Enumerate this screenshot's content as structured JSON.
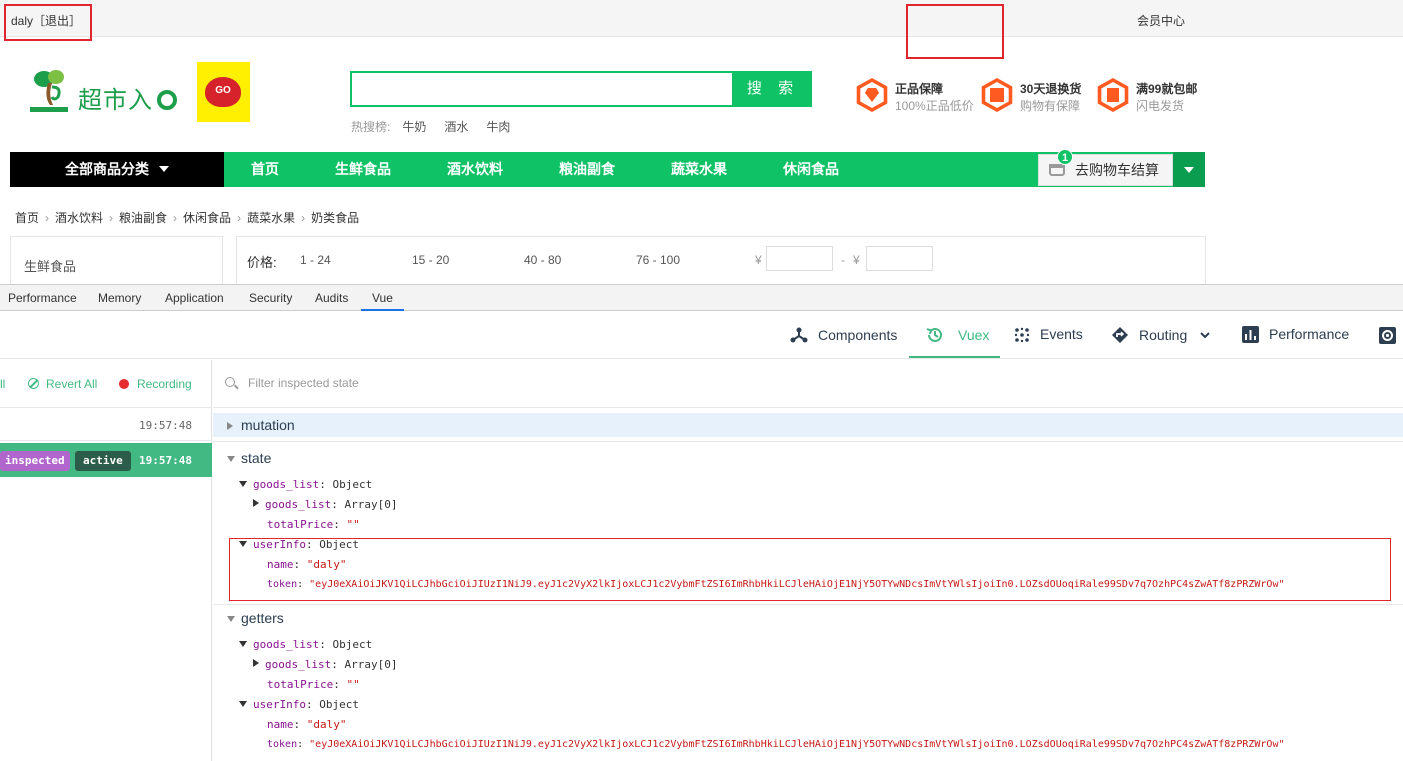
{
  "site": {
    "user": "daly［退出］",
    "member_center": "会员中心",
    "logo_text": "超市入",
    "logo_badge": "GO",
    "search_button": "搜 索",
    "hot_label": "热搜榜:",
    "hot_items": [
      "牛奶",
      "酒水",
      "牛肉"
    ],
    "promises": [
      {
        "title": "正品保障",
        "sub": "100%正品低价"
      },
      {
        "title": "30天退换货",
        "sub": "购物有保障"
      },
      {
        "title": "满99就包邮",
        "sub": "闪电发货"
      }
    ],
    "nav_all": "全部商品分类",
    "nav_items": [
      "首页",
      "生鲜食品",
      "酒水饮料",
      "粮油副食",
      "蔬菜水果",
      "休闲食品"
    ],
    "cart_label": "去购物车结算",
    "cart_count": "1",
    "breadcrumb": [
      "首页",
      "酒水饮料",
      "粮油副食",
      "休闲食品",
      "蔬菜水果",
      "奶类食品"
    ],
    "category": "生鲜食品",
    "price_label": "价格:",
    "price_ranges": [
      "1 - 24",
      "15 - 20",
      "40 - 80",
      "76 - 100"
    ],
    "currency": "¥",
    "dash": "-"
  },
  "devtools": {
    "tabs": [
      "Performance",
      "Memory",
      "Application",
      "Security",
      "Audits",
      "Vue"
    ],
    "active_tab": "Vue",
    "vue_tabs": [
      "Components",
      "Vuex",
      "Events",
      "Routing",
      "Performance"
    ],
    "active_vue_tab": "Vuex",
    "left_toolbar": {
      "partial": "ll",
      "revert": "Revert All",
      "recording": "Recording"
    },
    "history": [
      {
        "time": "19:57:48"
      },
      {
        "tag1": "inspected",
        "tag2": "active",
        "time": "19:57:48"
      }
    ],
    "filter_placeholder": "Filter inspected state",
    "sections": {
      "mutation": "mutation",
      "state": "state",
      "getters": "getters"
    },
    "tree": {
      "goods_list_key": "goods_list",
      "object": "Object",
      "array0": "Array[0]",
      "totalPrice_key": "totalPrice",
      "empty_str": "\"\"",
      "userInfo_key": "userInfo",
      "name_key": "name",
      "name_val": "\"daly\"",
      "token_key": "token",
      "token_val": "\"eyJ0eXAiOiJKV1QiLCJhbGciOiJIUzI1NiJ9.eyJ1c2VyX2lkIjoxLCJ1c2VybmFtZSI6ImRhbHkiLCJleHAiOjE1NjY5OTYwNDcsImVtYWlsIjoiIn0.LOZsdOUoqiRale99SDv7q7OzhPC4sZwATf8zPRZWrOw\""
    }
  }
}
